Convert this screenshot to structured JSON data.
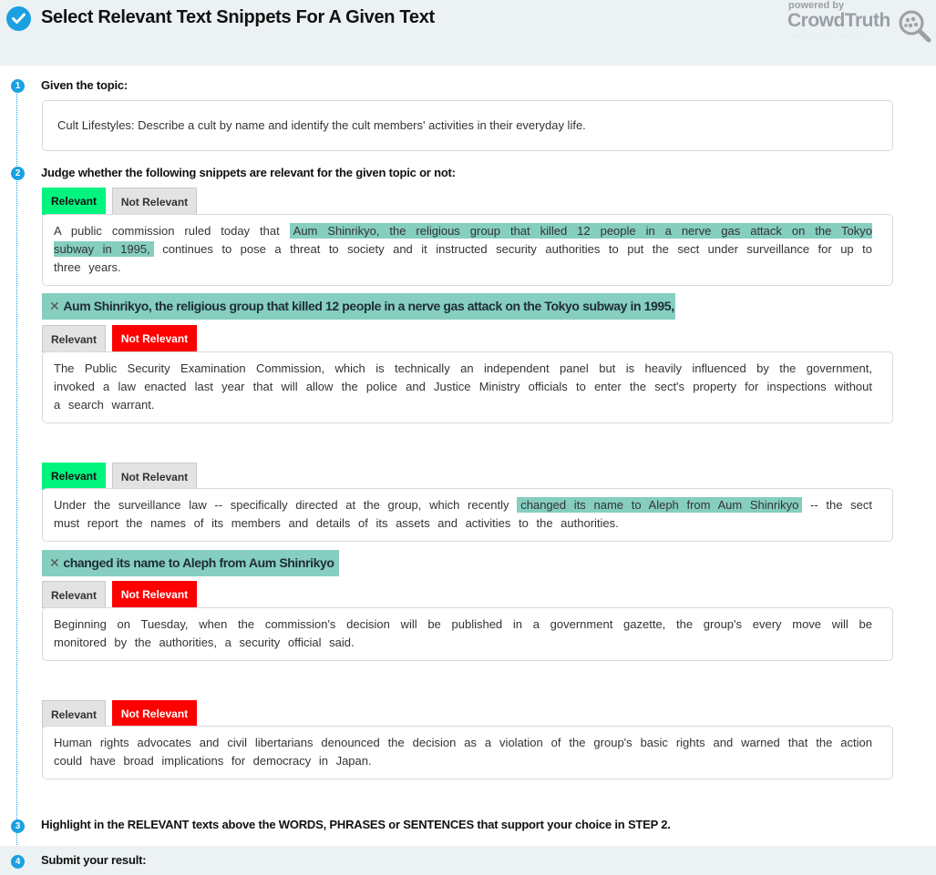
{
  "header": {
    "title": "Select Relevant Text Snippets For A Given Text",
    "brand_powered": "powered by",
    "brand_name": "CrowdTruth",
    "accent": "#1ba1e2"
  },
  "steps": [
    {
      "num": "1",
      "label": "Given the topic:"
    },
    {
      "num": "2",
      "label": "Judge whether the following snippets are relevant for the given topic or not:"
    },
    {
      "num": "3",
      "label": "Highlight in the RELEVANT texts above the WORDS, PHRASES or SENTENCES that support your choice in STEP 2."
    },
    {
      "num": "4",
      "label": "Submit your result:"
    }
  ],
  "topic": "Cult Lifestyles: Describe a cult by name and identify the cult members' activities in their everyday life.",
  "buttons": {
    "relevant": "Relevant",
    "not_relevant": "Not Relevant"
  },
  "snippets": [
    {
      "selected": "Relevant",
      "pre": "A public commission ruled today that ",
      "highlight": "Aum Shinrikyo, the religious group that killed 12 people in a nerve gas attack on the Tokyo subway in 1995,",
      "post": " continues to pose a threat to society and it instructed security authorities to put the sect under surveillance for up to three years.",
      "chip": "Aum Shinrikyo, the religious group that killed 12 people in a nerve gas attack on the Tokyo subway in 1995,"
    },
    {
      "selected": "Not Relevant",
      "text": "The Public Security Examination Commission, which is technically an independent panel but is heavily influenced by the government, invoked a law enacted last year that will allow the police and Justice Ministry officials to enter the sect's property for inspections without a search warrant."
    },
    {
      "selected": "Relevant",
      "pre": "Under the surveillance law -- specifically directed at the group, which recently ",
      "highlight": "changed its name to Aleph from Aum Shinrikyo",
      "post": " -- the sect must report the names of its members and details of its assets and activities to the authorities.",
      "chip": "changed its name to Aleph from Aum Shinrikyo"
    },
    {
      "selected": "Not Relevant",
      "text": "Beginning on Tuesday, when the commission's decision will be published in a government gazette, the group's every move will be monitored by the authorities, a security official said."
    },
    {
      "selected": "Not Relevant",
      "text": "Human rights advocates and civil libertarians denounced the decision as a violation of the group's basic rights and warned that the action could have broad implications for democracy in Japan."
    }
  ]
}
